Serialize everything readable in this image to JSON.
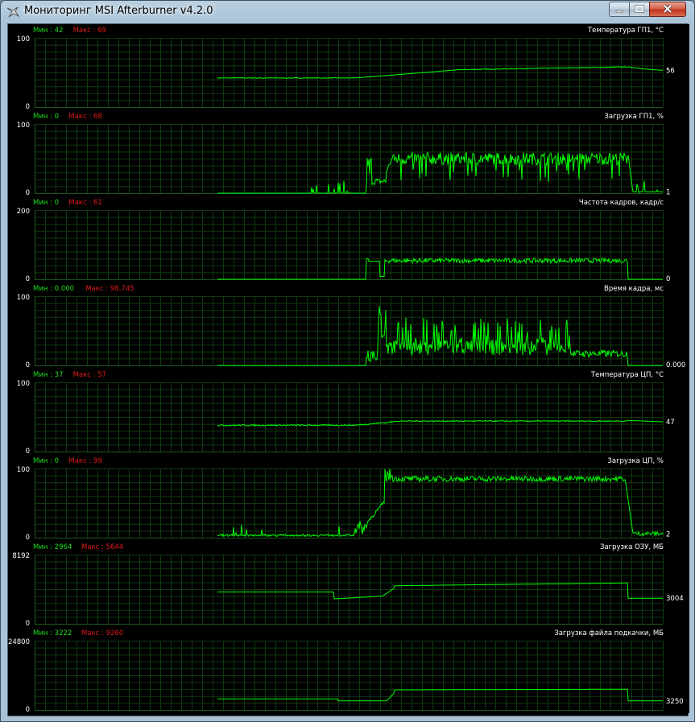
{
  "window": {
    "title": "Мониторинг MSI Afterburner v4.2.0",
    "title_icon": "afterburner-app-icon",
    "buttons": {
      "minimize": "minimize-icon",
      "maximize": "maximize-icon",
      "close": "close-icon"
    }
  },
  "colors": {
    "background": "#000000",
    "grid": "#0f3a0f",
    "line": "#00ff00",
    "min_label": "#19e019",
    "max_label": "#e01a1a",
    "text": "#ffffff"
  },
  "panels": [
    {
      "title": "Температура ГП1, °С",
      "min_text": "Мин : 42",
      "max_text": "Макс : 69",
      "axis_max": "100",
      "axis_min": "0",
      "current": "56"
    },
    {
      "title": "Загрузка ГП1, %",
      "min_text": "Мин : 0",
      "max_text": "Макс : 68",
      "axis_max": "100",
      "axis_min": "0",
      "current": "1"
    },
    {
      "title": "Частота кадров, кадр/с",
      "min_text": "Мин : 0",
      "max_text": "Макс : 61",
      "axis_max": "200",
      "axis_min": "0",
      "current": "0"
    },
    {
      "title": "Время кадра, мс",
      "min_text": "Мин : 0.000",
      "max_text": "Макс : 98.745",
      "axis_max": "100",
      "axis_min": "0",
      "current": "0.000"
    },
    {
      "title": "Температура ЦП, °С",
      "min_text": "Мин : 37",
      "max_text": "Макс : 57",
      "axis_max": "100",
      "axis_min": "0",
      "current": "47"
    },
    {
      "title": "Загрузка ЦП, %",
      "min_text": "Мин : 0",
      "max_text": "Макс : 99",
      "axis_max": "100",
      "axis_min": "0",
      "current": "2"
    },
    {
      "title": "Загрузка ОЗУ, МБ",
      "min_text": "Мин : 2964",
      "max_text": "Макс : 5644",
      "axis_max": "8192",
      "axis_min": "0",
      "current": "3004"
    },
    {
      "title": "Загрузка файла подкачки, МБ",
      "min_text": "Мин : 3222",
      "max_text": "Макс : 9260",
      "axis_max": "24800",
      "axis_min": "0",
      "current": "3250"
    }
  ]
}
